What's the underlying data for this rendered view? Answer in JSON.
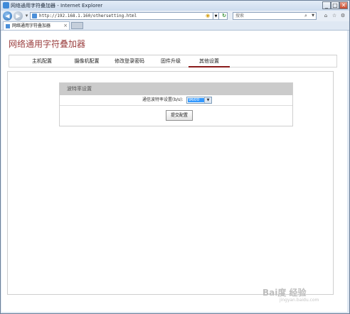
{
  "window": {
    "title": "网络通用字符叠加器 - Internet Explorer"
  },
  "address_bar": {
    "url": "http://192.168.1.160/othersetting.html"
  },
  "search": {
    "placeholder": "搜索"
  },
  "tab": {
    "label": "网络通用字符叠加器"
  },
  "page": {
    "title": "网络通用字符叠加器"
  },
  "menu": {
    "items": [
      {
        "label": "主机配置"
      },
      {
        "label": "摄像机配置"
      },
      {
        "label": "修改登录密码"
      },
      {
        "label": "固件升级"
      },
      {
        "label": "其他设置",
        "active": true
      }
    ]
  },
  "baud_section": {
    "header": "波特率设置",
    "field_label": "通信波特率设置(b/s):",
    "selected_value": "9600",
    "submit_label": "提交配置"
  },
  "watermark": {
    "brand": "Bai度 经验",
    "sub": "jingyan.baidu.com"
  }
}
